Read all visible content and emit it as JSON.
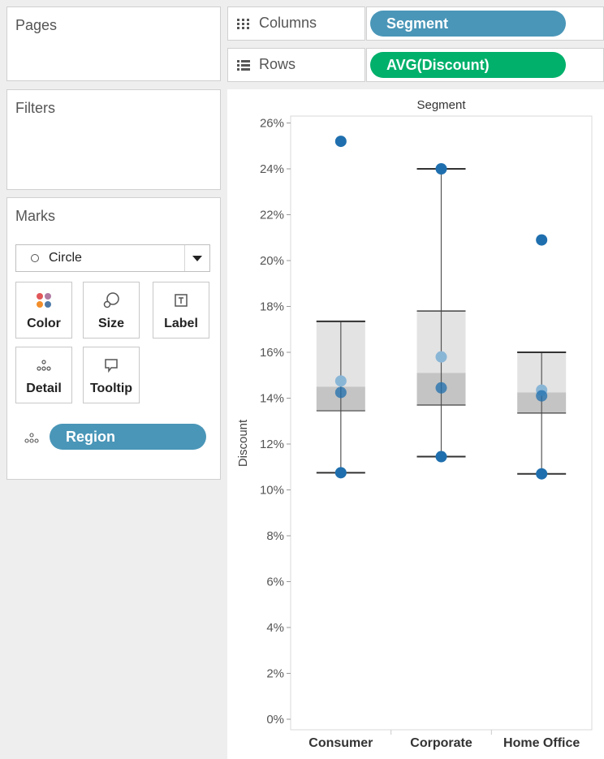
{
  "cards": {
    "pages": {
      "title": "Pages"
    },
    "filters": {
      "title": "Filters"
    },
    "marks": {
      "title": "Marks",
      "mark_type": "Circle",
      "buttons": [
        {
          "label": "Color",
          "icon": "color-icon"
        },
        {
          "label": "Size",
          "icon": "size-icon"
        },
        {
          "label": "Label",
          "icon": "label-icon"
        },
        {
          "label": "Detail",
          "icon": "detail-icon"
        },
        {
          "label": "Tooltip",
          "icon": "tooltip-icon"
        }
      ],
      "detail_field": "Region"
    }
  },
  "shelves": {
    "columns": {
      "label": "Columns",
      "pill": "Segment",
      "pill_color": "#4a96b8"
    },
    "rows": {
      "label": "Rows",
      "pill": "AVG(Discount)",
      "pill_color": "#00b06b"
    }
  },
  "colors": {
    "dimension_pill": "#4a96b8",
    "measure_pill": "#00b06b",
    "mark_dark": "#1f6fae",
    "mark_light": "#8ab6d6",
    "box_upper": "#e3e3e3",
    "box_lower": "#c4c4c4",
    "whisker": "#555555"
  },
  "chart_data": {
    "type": "scatter",
    "title": "Segment",
    "xlabel": "",
    "ylabel": "Discount",
    "categories": [
      "Consumer",
      "Corporate",
      "Home Office"
    ],
    "y_tick_labels": [
      "0%",
      "2%",
      "4%",
      "6%",
      "8%",
      "10%",
      "12%",
      "14%",
      "16%",
      "18%",
      "20%",
      "22%",
      "24%",
      "26%"
    ],
    "ylim": [
      0,
      0.27
    ],
    "grid": false,
    "legend": "none",
    "points": [
      {
        "category": "Consumer",
        "values": [
          0.252,
          0.1475,
          0.1425,
          0.1075
        ]
      },
      {
        "category": "Corporate",
        "values": [
          0.24,
          0.158,
          0.1445,
          0.1145
        ]
      },
      {
        "category": "Home Office",
        "values": [
          0.209,
          0.1435,
          0.141,
          0.107
        ]
      }
    ],
    "box_plots": [
      {
        "category": "Consumer",
        "min": 0.1075,
        "q1": 0.1345,
        "median": 0.145,
        "q3": 0.1735,
        "max": 0.1075,
        "whisker_low": 0.1075,
        "whisker_high": 0.1735
      },
      {
        "category": "Corporate",
        "min": 0.1145,
        "q1": 0.137,
        "median": 0.151,
        "q3": 0.178,
        "max": 0.24,
        "whisker_low": 0.1145,
        "whisker_high": 0.24
      },
      {
        "category": "Home Office",
        "min": 0.107,
        "q1": 0.1335,
        "median": 0.1425,
        "q3": 0.16,
        "max": 0.16,
        "whisker_low": 0.107,
        "whisker_high": 0.16
      }
    ]
  }
}
